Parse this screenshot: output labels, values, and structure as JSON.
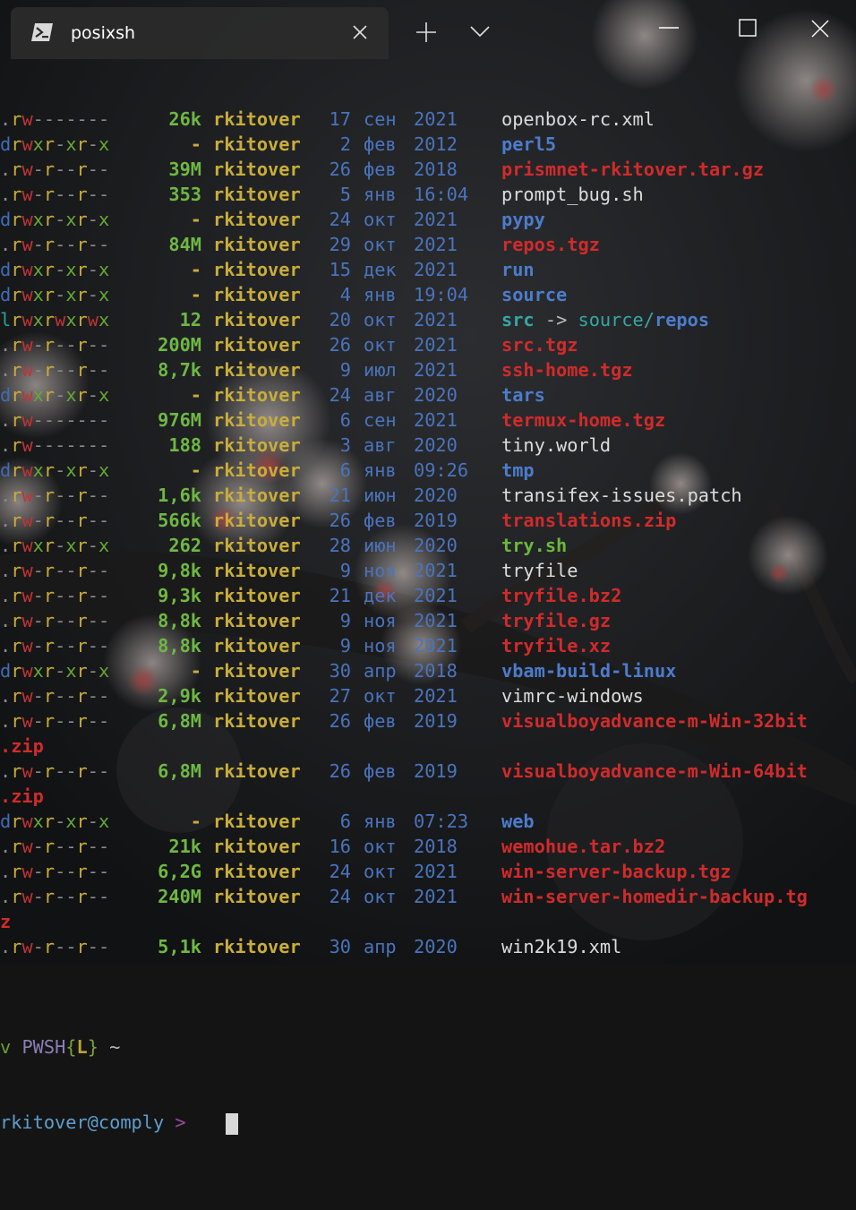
{
  "window": {
    "tab_title": "posixsh",
    "icons": {
      "tab": "powershell-icon",
      "close_tab": "close-icon",
      "new_tab": "plus-icon",
      "dropdown": "chevron-down-icon",
      "minimize": "minimize-icon",
      "maximize": "maximize-icon",
      "close_window": "close-icon"
    }
  },
  "colors": {
    "user": "#c8ad3a",
    "size": "#6eb843",
    "date": "#4a74bd",
    "directory": "#4c7ccc",
    "archive": "#d02b2b",
    "executable": "#6ab83d",
    "symlink": "#35a7a3",
    "plain_file": "#dcdcdc"
  },
  "listing": [
    {
      "perm": ".rw-------",
      "size": "26k",
      "user": "rkitover",
      "day": "17",
      "month": "сен",
      "year": "2021",
      "name": "openbox-rc.xml",
      "kind": "file"
    },
    {
      "perm": "drwxr-xr-x",
      "size": "-",
      "user": "rkitover",
      "day": "2",
      "month": "фев",
      "year": "2012",
      "name": "perl5",
      "kind": "dir"
    },
    {
      "perm": ".rw-r--r--",
      "size": "39M",
      "user": "rkitover",
      "day": "26",
      "month": "фев",
      "year": "2018",
      "name": "prismnet-rkitover.tar.gz",
      "kind": "archive"
    },
    {
      "perm": ".rw-r--r--",
      "size": "353",
      "user": "rkitover",
      "day": "5",
      "month": "янв",
      "year": "16:04",
      "name": "prompt_bug.sh",
      "kind": "file"
    },
    {
      "perm": "drwxr-xr-x",
      "size": "-",
      "user": "rkitover",
      "day": "24",
      "month": "окт",
      "year": "2021",
      "name": "pypy",
      "kind": "dir"
    },
    {
      "perm": ".rw-r--r--",
      "size": "84M",
      "user": "rkitover",
      "day": "29",
      "month": "окт",
      "year": "2021",
      "name": "repos.tgz",
      "kind": "archive"
    },
    {
      "perm": "drwxr-xr-x",
      "size": "-",
      "user": "rkitover",
      "day": "15",
      "month": "дек",
      "year": "2021",
      "name": "run",
      "kind": "dir"
    },
    {
      "perm": "drwxr-xr-x",
      "size": "-",
      "user": "rkitover",
      "day": "4",
      "month": "янв",
      "year": "19:04",
      "name": "source",
      "kind": "dir"
    },
    {
      "perm": "lrwxrwxrwx",
      "size": "12",
      "user": "rkitover",
      "day": "20",
      "month": "окт",
      "year": "2021",
      "name": "src",
      "kind": "link",
      "arrow": "->",
      "target_dir": "source/",
      "target_name": "repos"
    },
    {
      "perm": ".rw-r--r--",
      "size": "200M",
      "user": "rkitover",
      "day": "26",
      "month": "окт",
      "year": "2021",
      "name": "src.tgz",
      "kind": "archive"
    },
    {
      "perm": ".rw-r--r--",
      "size": "8,7k",
      "user": "rkitover",
      "day": "9",
      "month": "июл",
      "year": "2021",
      "name": "ssh-home.tgz",
      "kind": "archive"
    },
    {
      "perm": "drwxr-xr-x",
      "size": "-",
      "user": "rkitover",
      "day": "24",
      "month": "авг",
      "year": "2020",
      "name": "tars",
      "kind": "dir"
    },
    {
      "perm": ".rw-------",
      "size": "976M",
      "user": "rkitover",
      "day": "6",
      "month": "сен",
      "year": "2021",
      "name": "termux-home.tgz",
      "kind": "archive"
    },
    {
      "perm": ".rw-------",
      "size": "188",
      "user": "rkitover",
      "day": "3",
      "month": "авг",
      "year": "2020",
      "name": "tiny.world",
      "kind": "file"
    },
    {
      "perm": "drwxr-xr-x",
      "size": "-",
      "user": "rkitover",
      "day": "6",
      "month": "янв",
      "year": "09:26",
      "name": "tmp",
      "kind": "dir"
    },
    {
      "perm": ".rw-r--r--",
      "size": "1,6k",
      "user": "rkitover",
      "day": "21",
      "month": "июн",
      "year": "2020",
      "name": "transifex-issues.patch",
      "kind": "file"
    },
    {
      "perm": ".rw-r--r--",
      "size": "566k",
      "user": "rkitover",
      "day": "26",
      "month": "фев",
      "year": "2019",
      "name": "translations.zip",
      "kind": "archive"
    },
    {
      "perm": ".rwxr-xr-x",
      "size": "262",
      "user": "rkitover",
      "day": "28",
      "month": "июн",
      "year": "2020",
      "name": "try.sh",
      "kind": "exec"
    },
    {
      "perm": ".rw-r--r--",
      "size": "9,8k",
      "user": "rkitover",
      "day": "9",
      "month": "ноя",
      "year": "2021",
      "name": "tryfile",
      "kind": "file"
    },
    {
      "perm": ".rw-r--r--",
      "size": "9,3k",
      "user": "rkitover",
      "day": "21",
      "month": "дек",
      "year": "2021",
      "name": "tryfile.bz2",
      "kind": "archive"
    },
    {
      "perm": ".rw-r--r--",
      "size": "8,8k",
      "user": "rkitover",
      "day": "9",
      "month": "ноя",
      "year": "2021",
      "name": "tryfile.gz",
      "kind": "archive"
    },
    {
      "perm": ".rw-r--r--",
      "size": "8,8k",
      "user": "rkitover",
      "day": "9",
      "month": "ноя",
      "year": "2021",
      "name": "tryfile.xz",
      "kind": "archive"
    },
    {
      "perm": "drwxr-xr-x",
      "size": "-",
      "user": "rkitover",
      "day": "30",
      "month": "апр",
      "year": "2018",
      "name": "vbam-build-linux",
      "kind": "dir"
    },
    {
      "perm": ".rw-r--r--",
      "size": "2,9k",
      "user": "rkitover",
      "day": "27",
      "month": "окт",
      "year": "2021",
      "name": "vimrc-windows",
      "kind": "file"
    },
    {
      "perm": ".rw-r--r--",
      "size": "6,8M",
      "user": "rkitover",
      "day": "26",
      "month": "фев",
      "year": "2019",
      "name": "visualboyadvance-m-Win-32bit",
      "wrap": ".zip",
      "kind": "archive"
    },
    {
      "perm": ".rw-r--r--",
      "size": "6,8M",
      "user": "rkitover",
      "day": "26",
      "month": "фев",
      "year": "2019",
      "name": "visualboyadvance-m-Win-64bit",
      "wrap": ".zip",
      "kind": "archive"
    },
    {
      "perm": "drwxr-xr-x",
      "size": "-",
      "user": "rkitover",
      "day": "6",
      "month": "янв",
      "year": "07:23",
      "name": "web",
      "kind": "dir"
    },
    {
      "perm": ".rw-r--r--",
      "size": "21k",
      "user": "rkitover",
      "day": "16",
      "month": "окт",
      "year": "2018",
      "name": "wemohue.tar.bz2",
      "kind": "archive"
    },
    {
      "perm": ".rw-r--r--",
      "size": "6,2G",
      "user": "rkitover",
      "day": "24",
      "month": "окт",
      "year": "2021",
      "name": "win-server-backup.tgz",
      "kind": "archive"
    },
    {
      "perm": ".rw-r--r--",
      "size": "240M",
      "user": "rkitover",
      "day": "24",
      "month": "окт",
      "year": "2021",
      "name": "win-server-homedir-backup.tg",
      "wrap": "z",
      "kind": "archive"
    },
    {
      "perm": ".rw-r--r--",
      "size": "5,1k",
      "user": "rkitover",
      "day": "30",
      "month": "апр",
      "year": "2020",
      "name": "win2k19.xml",
      "kind": "file"
    }
  ],
  "prompt": {
    "v": "v",
    "shell": "PWSH",
    "open_brace": "{",
    "mode": "L",
    "close_brace": "}",
    "cwd": "~",
    "user_host": "rkitover@comply",
    "symbol": ">"
  }
}
